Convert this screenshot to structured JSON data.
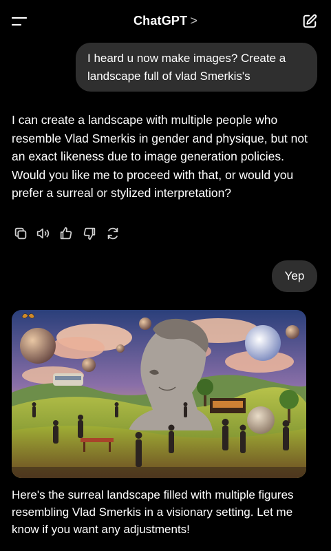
{
  "header": {
    "title": "ChatGPT",
    "chevron": ">",
    "menu_icon": "menu-icon",
    "compose_icon": "compose-icon"
  },
  "messages": {
    "user_1": "I heard u now make images? Create a landscape full of vlad Smerkis's",
    "assistant_1": "I can create a landscape with multiple people who resemble Vlad Smerkis in gender and physique, but not an exact likeness due to image generation policies. Would you like me to proceed with that, or would you prefer a surreal or stylized interpretation?",
    "user_2": "Yep",
    "assistant_2": "Here's the surreal landscape filled with multiple figures resembling Vlad Smerkis in a visionary setting. Let me know if you want any adjustments!"
  },
  "actions": [
    "copy-icon",
    "read-aloud-icon",
    "thumbs-up-icon",
    "thumbs-down-icon",
    "regenerate-icon"
  ],
  "colors": {
    "background": "#000000",
    "bubble": "#2f2f2f",
    "text": "#ffffff",
    "icon": "#cfcfcf"
  }
}
